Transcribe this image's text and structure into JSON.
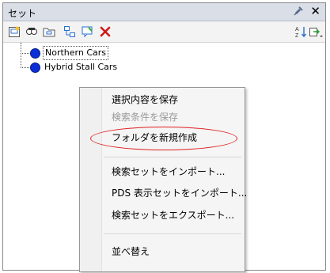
{
  "window": {
    "title": "セット",
    "close_glyph": "✕"
  },
  "toolbar": {
    "icons": [
      "save-selection-icon",
      "save-search-icon",
      "new-folder-icon",
      "rename-icon",
      "update-icon",
      "delete-icon",
      "sort-icon",
      "import-export-icon"
    ],
    "delete_color": "#d01818",
    "sort_label": "A↓Z"
  },
  "tree": {
    "items": [
      {
        "label": "Northern Cars"
      },
      {
        "label": "Hybrid Stall Cars"
      }
    ],
    "icon_color": "#0b2fd6"
  },
  "context_menu": {
    "items": [
      {
        "label": "選択内容を保存"
      },
      {
        "label": "検索条件を保存"
      },
      {
        "label": "フォルダを新規作成"
      },
      {
        "label": "検索セットをインポート..."
      },
      {
        "label": "PDS 表示セットをインポート..."
      },
      {
        "label": "検索セットをエクスポート..."
      },
      {
        "label": "並べ替え"
      }
    ],
    "highlight_color": "#e0201f"
  }
}
